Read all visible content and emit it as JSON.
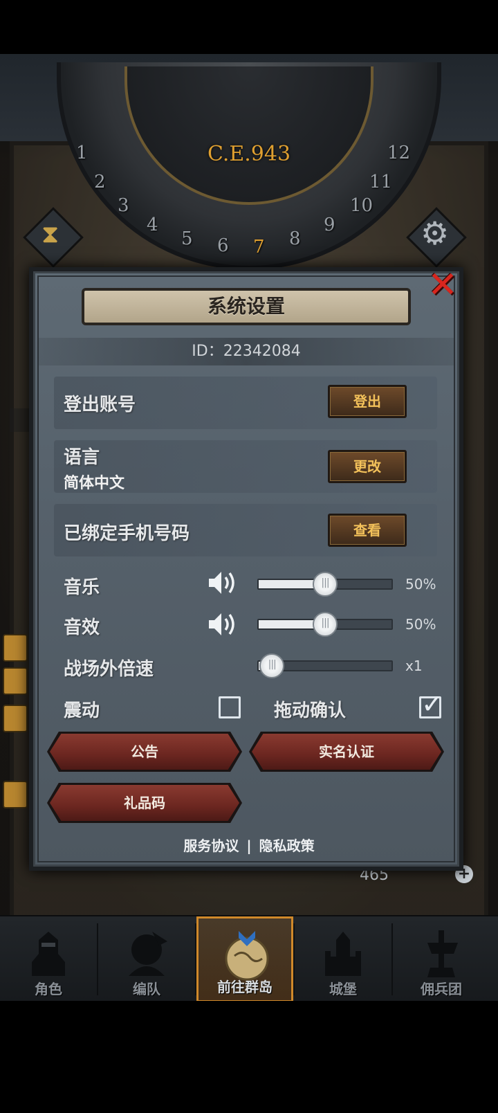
{
  "map": {
    "era": "C.E.943",
    "dial_numbers": [
      "1",
      "2",
      "3",
      "4",
      "5",
      "6",
      "7",
      "8",
      "9",
      "10",
      "11",
      "12"
    ],
    "dial_highlight": "7"
  },
  "dialog": {
    "title": "系统设置",
    "id_text": "ID：22342084",
    "account": {
      "label": "登出账号",
      "button": "登出"
    },
    "language": {
      "label": "语言",
      "value": "简体中文",
      "button": "更改"
    },
    "phone": {
      "label": "已绑定手机号码",
      "button": "查看"
    },
    "music": {
      "label": "音乐",
      "value_text": "50%",
      "level": 0.5
    },
    "sfx": {
      "label": "音效",
      "value_text": "50%",
      "level": 0.5
    },
    "speed": {
      "label": "战场外倍速",
      "value_text": "x1",
      "level": 0.1
    },
    "vibration": {
      "label": "震动",
      "checked": false
    },
    "drag_confirm": {
      "label": "拖动确认",
      "checked": true
    },
    "notice_button": "公告",
    "realname_button": "实名认证",
    "gift_button": "礼品码",
    "links": {
      "service": "服务协议",
      "separator": "|",
      "privacy": "隐私政策"
    }
  },
  "status": {
    "gems": "465"
  },
  "nav": {
    "items": [
      {
        "label": "角色",
        "icon": "knight-icon"
      },
      {
        "label": "编队",
        "icon": "team-icon"
      },
      {
        "label": "前往群岛",
        "icon": "globe-icon",
        "active": true
      },
      {
        "label": "城堡",
        "icon": "castle-icon"
      },
      {
        "label": "佣兵团",
        "icon": "mercenary-icon"
      }
    ]
  },
  "colors": {
    "accent_gold": "#e0a030",
    "close_red": "#d8261e",
    "button_text": "#f3c15a",
    "panel": "#56616b"
  }
}
